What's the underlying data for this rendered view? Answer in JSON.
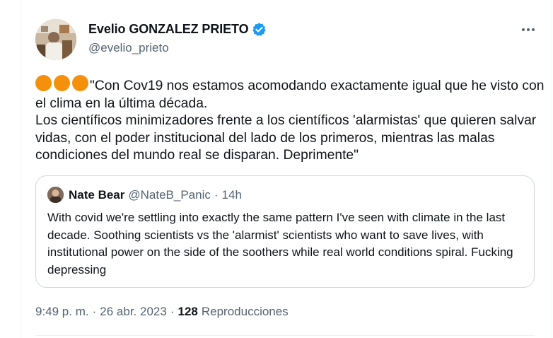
{
  "tweet": {
    "author": {
      "display_name": "Evelio GONZALEZ PRIETO",
      "handle": "@evelio_prieto",
      "verified": true,
      "avatar_icon": "profile-photo"
    },
    "more_icon": "ellipsis-icon",
    "emoji": [
      "🟠",
      "🟠",
      "🟠"
    ],
    "text": "\"Con Cov19 nos estamos acomodando exactamente igual que he visto con el clima en la última década.\nLos científicos minimizadores frente a los científicos 'alarmistas' que quieren salvar vidas, con el poder institucional del lado de los primeros, mientras las malas condiciones del mundo real se disparan. Deprimente\"",
    "quoted": {
      "display_name": "Nate Bear",
      "handle": "@NateB_Panic",
      "separator": "·",
      "age": "14h",
      "text": "With covid we're settling into exactly the same pattern I've seen with climate in the last decade. Soothing scientists vs the 'alarmist' scientists who want to save lives, with institutional power on the side of the soothers while real world conditions spiral. Fucking depressing"
    },
    "time": "9:49 p. m.",
    "separator": "·",
    "date": "26 abr. 2023",
    "views_count": "128",
    "views_label": "Reproducciones"
  },
  "colors": {
    "accent": "#1d9bf0",
    "secondary_text": "#536471",
    "border": "#cfd9de",
    "emoji_orange": "#f4900c"
  }
}
